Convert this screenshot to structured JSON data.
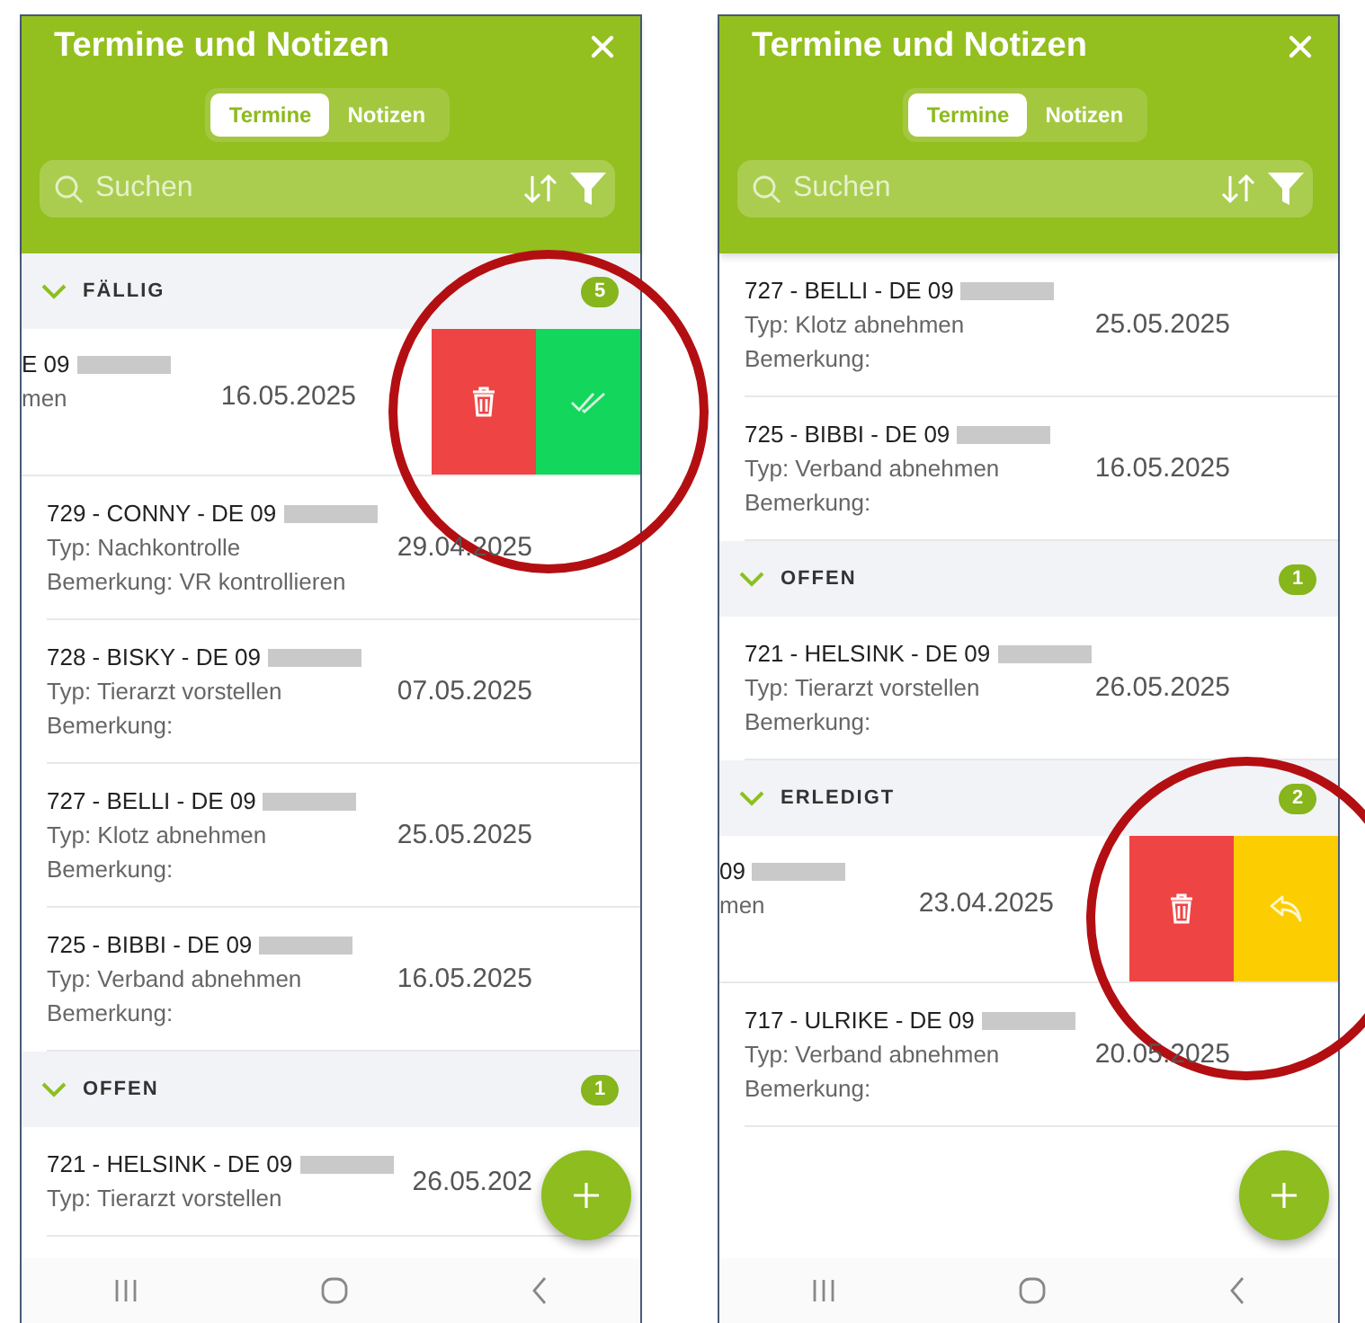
{
  "screens": [
    {
      "title": "Termine und Notizen",
      "tabs": [
        {
          "label": "Termine",
          "selected": true
        },
        {
          "label": "Notizen",
          "selected": false
        }
      ],
      "search": {
        "placeholder": "Suchen"
      },
      "list": [
        {
          "kind": "section",
          "label": "FÄLLIG",
          "count": "5",
          "expanded": true
        },
        {
          "kind": "swiped",
          "title": "E 09",
          "redacted": true,
          "typ": "men",
          "date": "16.05.2025",
          "highlighted": true,
          "actions": [
            {
              "kind": "delete"
            },
            {
              "kind": "done"
            }
          ]
        },
        {
          "kind": "entry",
          "title": "729 - CONNY - DE 09",
          "redacted": true,
          "typ": "Typ: Nachkontrolle",
          "bemerkung": "Bemerkung: VR kontrollieren",
          "date": "29.04.2025"
        },
        {
          "kind": "entry",
          "title": "728 - BISKY - DE 09",
          "redacted": true,
          "typ": "Typ: Tierarzt vorstellen",
          "bemerkung": "Bemerkung:",
          "date": "07.05.2025"
        },
        {
          "kind": "entry",
          "title": "727 - BELLI - DE 09",
          "redacted": true,
          "typ": "Typ: Klotz abnehmen",
          "bemerkung": "Bemerkung:",
          "date": "25.05.2025"
        },
        {
          "kind": "entry",
          "title": "725 - BIBBI - DE 09",
          "redacted": true,
          "typ": "Typ: Verband abnehmen",
          "bemerkung": "Bemerkung:",
          "date": "16.05.2025"
        },
        {
          "kind": "section",
          "label": "OFFEN",
          "count": "1",
          "expanded": true
        },
        {
          "kind": "entry",
          "title": "721 - HELSINK - DE 09",
          "redacted": true,
          "typ": "Typ: Tierarzt vorstellen",
          "date": "26.05.202"
        }
      ]
    },
    {
      "title": "Termine und Notizen",
      "tabs": [
        {
          "label": "Termine",
          "selected": true
        },
        {
          "label": "Notizen",
          "selected": false
        }
      ],
      "search": {
        "placeholder": "Suchen"
      },
      "list": [
        {
          "kind": "entry",
          "title": "727 - BELLI - DE 09",
          "redacted": true,
          "typ": "Typ: Klotz abnehmen",
          "bemerkung": "Bemerkung:",
          "date": "25.05.2025"
        },
        {
          "kind": "entry",
          "title": "725 - BIBBI - DE 09",
          "redacted": true,
          "typ": "Typ: Verband abnehmen",
          "bemerkung": "Bemerkung:",
          "date": "16.05.2025"
        },
        {
          "kind": "section",
          "label": "OFFEN",
          "count": "1",
          "expanded": true
        },
        {
          "kind": "entry",
          "title": "721 - HELSINK - DE 09",
          "redacted": true,
          "typ": "Typ: Tierarzt vorstellen",
          "bemerkung": "Bemerkung:",
          "date": "26.05.2025"
        },
        {
          "kind": "section",
          "label": "ERLEDIGT",
          "count": "2",
          "expanded": true
        },
        {
          "kind": "swiped",
          "title": "09",
          "redacted": true,
          "typ": "men",
          "date": "23.04.2025",
          "highlighted": true,
          "actions": [
            {
              "kind": "delete"
            },
            {
              "kind": "undo"
            }
          ]
        },
        {
          "kind": "entry",
          "title": "717 - ULRIKE - DE 09",
          "redacted": true,
          "typ": "Typ: Verband abnehmen",
          "bemerkung": "Bemerkung:",
          "date": "20.05.2025"
        }
      ]
    }
  ]
}
